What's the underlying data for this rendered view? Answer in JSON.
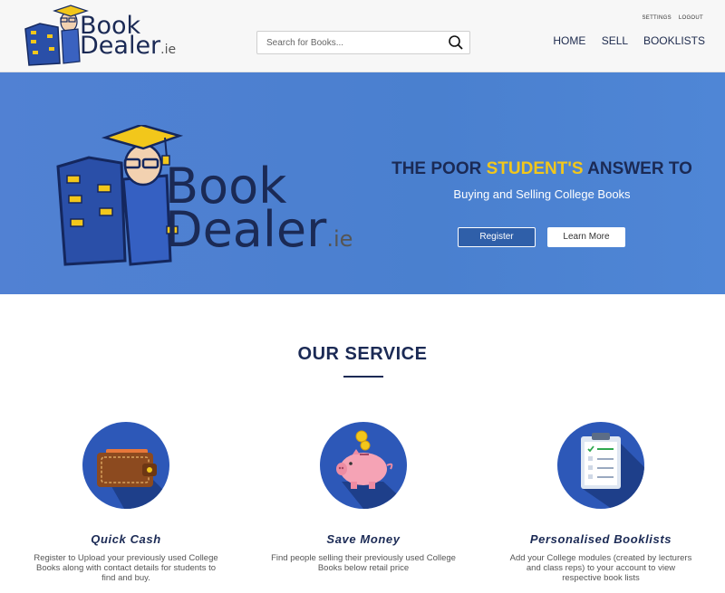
{
  "brand": {
    "logo_text_line1": "Book",
    "logo_text_line2": "Dealer",
    "logo_tld": ".ie"
  },
  "header": {
    "search": {
      "placeholder": "Search for Books..."
    },
    "util_links": [
      "SETTINGS",
      "LOGOUT"
    ],
    "nav": [
      "HOME",
      "SELL",
      "BOOKLISTS"
    ]
  },
  "hero": {
    "title_pre": "THE POOR ",
    "title_highlight": "STUDENT'S",
    "title_post": " ANSWER TO",
    "subtitle": "Buying and Selling College Books",
    "register_label": "Register",
    "learn_more_label": "Learn More"
  },
  "service": {
    "title": "OUR SERVICE",
    "cards": [
      {
        "title": "Quick Cash",
        "description": "Register to Upload your previously used College Books along with contact details for students to find and buy.",
        "icon": "wallet-icon"
      },
      {
        "title": "Save Money",
        "description": "Find people selling their previously used College Books below retail price",
        "icon": "piggy-bank-icon"
      },
      {
        "title": "Personalised Booklists",
        "description": "Add your College modules (created by lecturers and class reps) to your account to view respective book lists",
        "icon": "clipboard-checklist-icon"
      }
    ]
  },
  "colors": {
    "hero_bg": "#4c80d0",
    "navy": "#1b2a55",
    "accent_yellow": "#f2c71b",
    "circle_blue": "#2d58b8"
  }
}
